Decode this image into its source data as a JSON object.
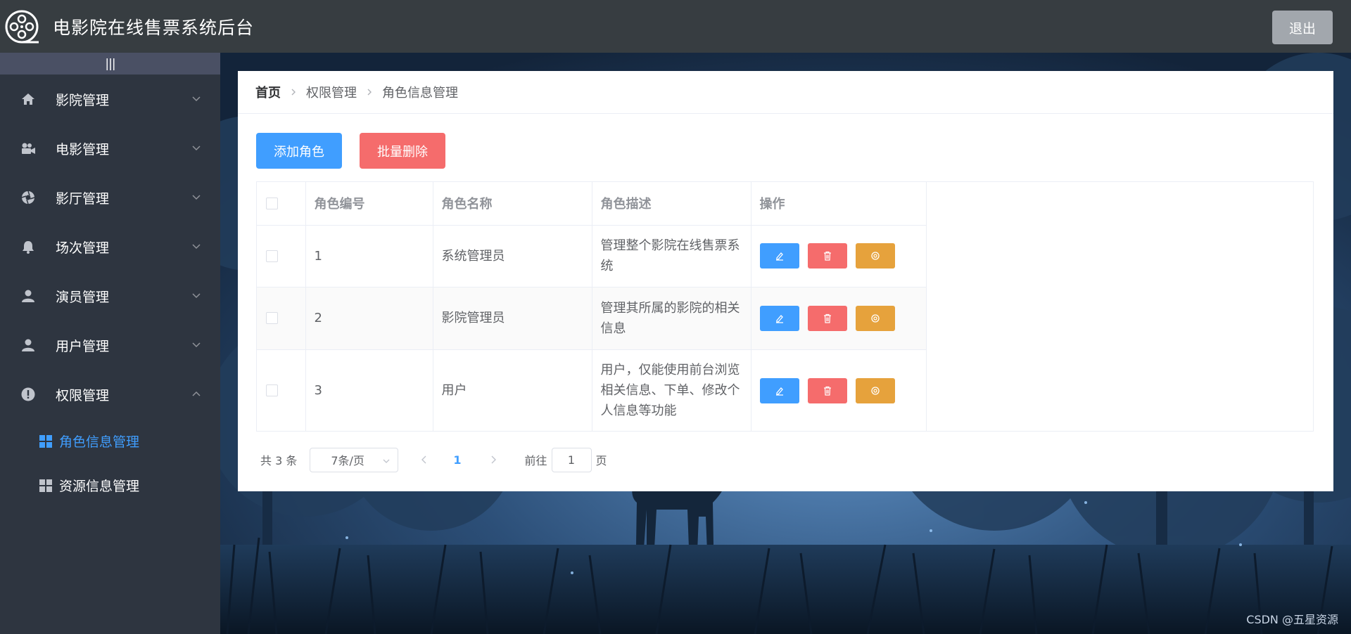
{
  "header": {
    "title": "电影院在线售票系统后台",
    "logout_label": "退出",
    "logo_icon": "film-reel-icon"
  },
  "sidebar": {
    "collapse_label": "|||",
    "items": [
      {
        "label": "影院管理",
        "icon": "home-icon",
        "expanded": false
      },
      {
        "label": "电影管理",
        "icon": "camera-icon",
        "expanded": false
      },
      {
        "label": "影厅管理",
        "icon": "aperture-icon",
        "expanded": false
      },
      {
        "label": "场次管理",
        "icon": "bell-icon",
        "expanded": false
      },
      {
        "label": "演员管理",
        "icon": "user-icon",
        "expanded": false
      },
      {
        "label": "用户管理",
        "icon": "user-icon",
        "expanded": false
      },
      {
        "label": "权限管理",
        "icon": "warning-icon",
        "expanded": true
      }
    ],
    "sub_items": [
      {
        "label": "角色信息管理",
        "icon": "grid-icon",
        "active": true
      },
      {
        "label": "资源信息管理",
        "icon": "grid-icon",
        "active": false
      }
    ],
    "active_color": "#409eff"
  },
  "breadcrumb": [
    "首页",
    "权限管理",
    "角色信息管理"
  ],
  "toolbar": {
    "add_label": "添加角色",
    "batch_delete_label": "批量删除"
  },
  "table": {
    "columns": [
      "角色编号",
      "角色名称",
      "角色描述",
      "操作"
    ],
    "rows": [
      {
        "id": "1",
        "name": "系统管理员",
        "desc": "管理整个影院在线售票系统"
      },
      {
        "id": "2",
        "name": "影院管理员",
        "desc": "管理其所属的影院的相关信息"
      },
      {
        "id": "3",
        "name": "用户",
        "desc": "用户，仅能使用前台浏览相关信息、下单、修改个人信息等功能"
      }
    ],
    "action_icons": [
      "edit-icon",
      "delete-icon",
      "permission-icon"
    ]
  },
  "pagination": {
    "total_text": "共 3 条",
    "page_size": "7条/页",
    "current_page": "1",
    "goto_prefix": "前往",
    "goto_value": "1",
    "goto_suffix": "页"
  },
  "watermark": "CSDN @五星资源",
  "colors": {
    "header_bg": "#373d41",
    "sidebar_bg": "#2e3540",
    "primary": "#409eff",
    "danger": "#f56c6c",
    "warning": "#e6a23c"
  }
}
